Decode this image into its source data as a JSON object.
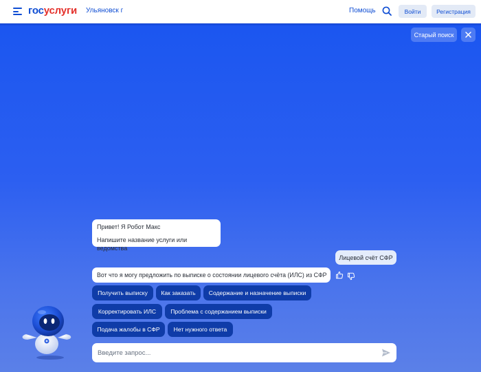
{
  "header": {
    "logo_part1": "гос",
    "logo_part2": "услуги",
    "city": "Ульяновск г",
    "help": "Помощь",
    "login": "Войти",
    "register": "Регистрация"
  },
  "toolbar": {
    "old_search": "Старый поиск"
  },
  "chat": {
    "greeting_line1": "Привет! Я Робот Макс",
    "greeting_line2": "Напишите название услуги или ведомства",
    "user_message": "Лицевой счёт СФР",
    "bot_message": "Вот что я могу предложить по выписке о состоянии лицевого счёта (ИЛС) из СФР",
    "chips": [
      "Получить выписку",
      "Как заказать",
      "Содержание и назначение выписки",
      "Корректировать ИЛС",
      "Проблема с содержанием выписки",
      "Подача жалобы в СФР",
      "Нет нужного ответа"
    ]
  },
  "input": {
    "placeholder": "Введите запрос..."
  },
  "colors": {
    "brand_blue": "#0d4cd3",
    "brand_red": "#e4312b",
    "chip_bg": "#0f3ca8"
  }
}
